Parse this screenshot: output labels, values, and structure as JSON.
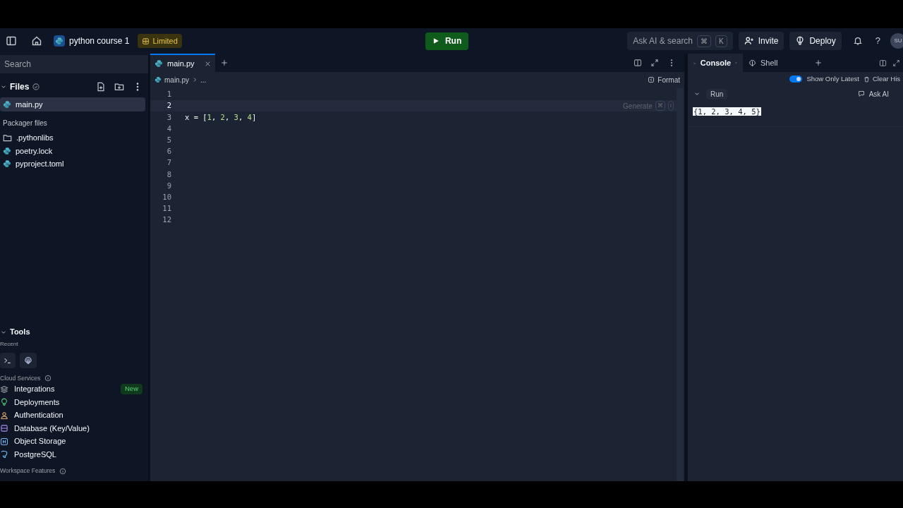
{
  "header": {
    "repl_name": "python course 1",
    "plan_badge": "Limited",
    "run_button": "Run",
    "search": "Ask AI & search",
    "search_keys": [
      "⌘",
      "K"
    ],
    "invite": "Invite",
    "deploy": "Deploy",
    "help": "?",
    "avatar": "SU"
  },
  "sidebar": {
    "search_placeholder": "Search",
    "files_title": "Files",
    "files": [
      {
        "name": "main.py",
        "kind": "python",
        "selected": true
      }
    ],
    "packager_title": "Packager files",
    "packager_files": [
      {
        "name": ".pythonlibs",
        "kind": "folder",
        "selected": false
      },
      {
        "name": "poetry.lock",
        "kind": "python",
        "selected": false
      },
      {
        "name": "pyproject.toml",
        "kind": "python",
        "selected": false
      }
    ],
    "tools_title": "Tools",
    "recent_title": "Recent",
    "cloud_title": "Cloud Services",
    "services": [
      {
        "name": "Integrations",
        "kind": "integrations",
        "badge": "New"
      },
      {
        "name": "Deployments",
        "kind": "deployments"
      },
      {
        "name": "Authentication",
        "kind": "auth"
      },
      {
        "name": "Database (Key/Value)",
        "kind": "database"
      },
      {
        "name": "Object Storage",
        "kind": "storage"
      },
      {
        "name": "PostgreSQL",
        "kind": "postgres"
      }
    ],
    "workspace_title": "Workspace Features"
  },
  "editor": {
    "tabs": [
      {
        "label": "main.py",
        "selected": true
      }
    ],
    "breadcrumb": [
      "main.py",
      "..."
    ],
    "format": "Format",
    "generate": "Generate",
    "generate_keys": [
      "⌘",
      "I"
    ],
    "lines": [
      {
        "number": "1",
        "current": false
      },
      {
        "number": "2",
        "current": true
      },
      {
        "number": "3",
        "current": false,
        "tokens": [
          {
            "text": "x = [",
            "kind": "plain"
          },
          {
            "text": "1",
            "kind": "number"
          },
          {
            "text": ", ",
            "kind": "plain"
          },
          {
            "text": "2",
            "kind": "number"
          },
          {
            "text": ", ",
            "kind": "plain"
          },
          {
            "text": "3",
            "kind": "number"
          },
          {
            "text": ", ",
            "kind": "plain"
          },
          {
            "text": "4",
            "kind": "number"
          },
          {
            "text": "]",
            "kind": "plain"
          }
        ]
      },
      {
        "number": "4",
        "current": false
      },
      {
        "number": "5",
        "current": false
      },
      {
        "number": "6",
        "current": false
      },
      {
        "number": "7",
        "current": false
      },
      {
        "number": "8",
        "current": false
      },
      {
        "number": "9",
        "current": false
      },
      {
        "number": "10",
        "current": false
      },
      {
        "number": "11",
        "current": false
      },
      {
        "number": "12",
        "current": false
      }
    ]
  },
  "console": {
    "tabs": [
      {
        "label": "Console",
        "kind": "console",
        "selected": true
      },
      {
        "label": "Shell",
        "kind": "shell",
        "selected": false
      }
    ],
    "show_only_latest": {
      "label": "Show Only Latest",
      "on": true
    },
    "clear_history": "Clear His",
    "run_label": "Run",
    "ask_ai": "Ask AI",
    "output": {
      "text": "{1, 2, 3, 4, 5}",
      "selected": true
    }
  }
}
